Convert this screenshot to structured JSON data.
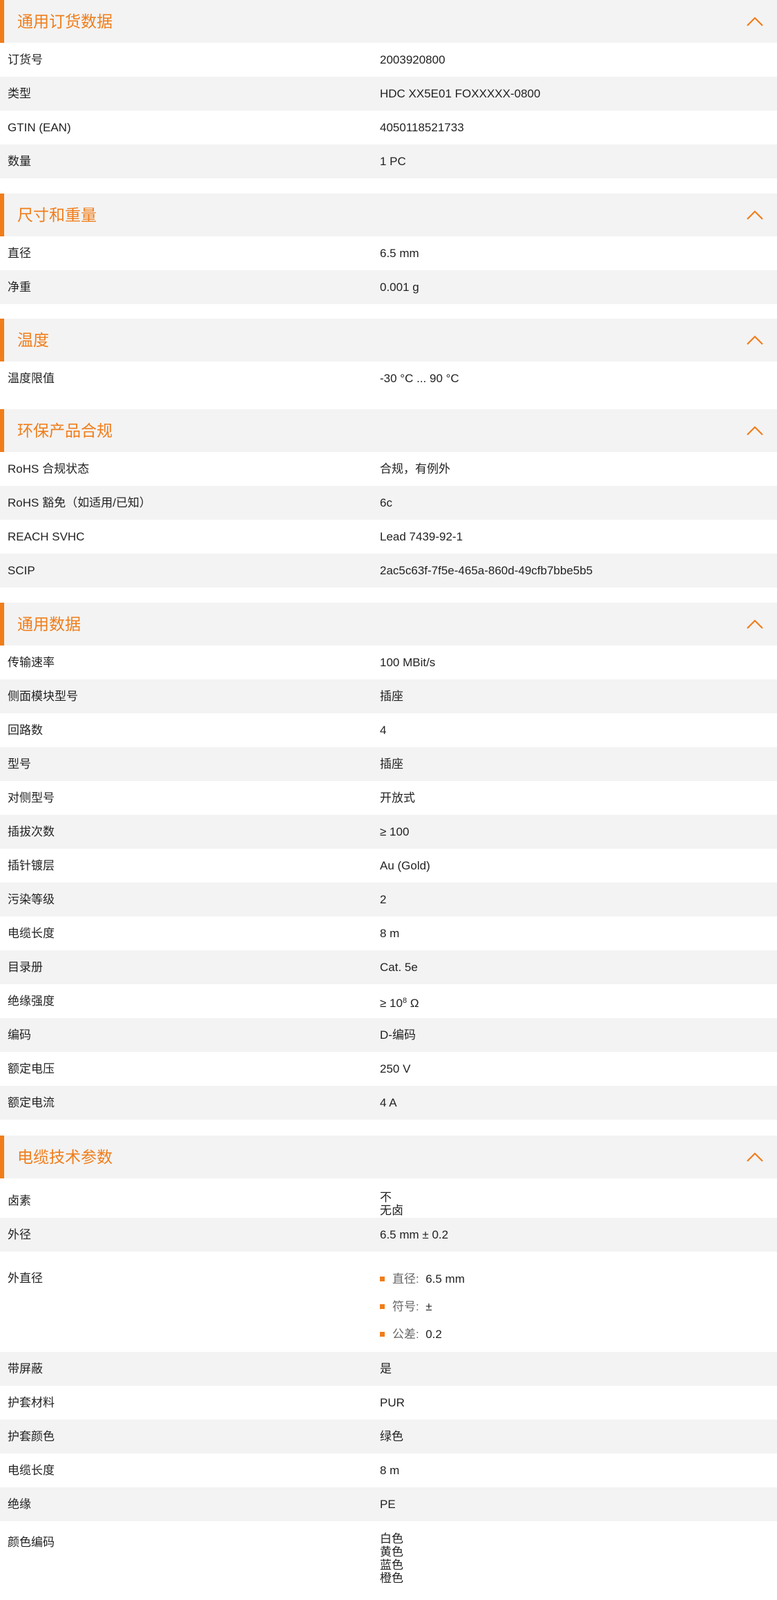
{
  "accent_color": "#f07d1a",
  "sections": [
    {
      "title": "通用订货数据",
      "rows": [
        {
          "label": "订货号",
          "value": "2003920800"
        },
        {
          "label": "类型",
          "value": "HDC XX5E01 FOXXXXX-0800"
        },
        {
          "label": "GTIN (EAN)",
          "value": "4050118521733"
        },
        {
          "label": "数量",
          "value": "1  PC"
        }
      ]
    },
    {
      "title": "尺寸和重量",
      "rows": [
        {
          "label": "直径",
          "value": "6.5  mm"
        },
        {
          "label": "净重",
          "value": "0.001  g"
        }
      ]
    },
    {
      "title": "温度",
      "rows": [
        {
          "label": "温度限值",
          "value": "-30 °C ... 90 °C"
        }
      ]
    },
    {
      "title": "环保产品合规",
      "rows": [
        {
          "label": "RoHS 合规状态",
          "value": "合规，有例外"
        },
        {
          "label": "RoHS 豁免（如适用/已知）",
          "value": "6c"
        },
        {
          "label": "REACH SVHC",
          "value": "Lead 7439-92-1"
        },
        {
          "label": "SCIP",
          "value": "2ac5c63f-7f5e-465a-860d-49cfb7bbe5b5"
        }
      ]
    },
    {
      "title": "通用数据",
      "rows": [
        {
          "label": "传输速率",
          "value": "100 MBit/s"
        },
        {
          "label": "侧面模块型号",
          "value": "插座"
        },
        {
          "label": "回路数",
          "value": "4"
        },
        {
          "label": "型号",
          "value": "插座"
        },
        {
          "label": "对侧型号",
          "value": "开放式"
        },
        {
          "label": "插拔次数",
          "value": "≥ 100"
        },
        {
          "label": "插针镀层",
          "value": "Au (Gold)"
        },
        {
          "label": "污染等级",
          "value": "2"
        },
        {
          "label": "电缆长度",
          "value": "8  m"
        },
        {
          "label": "目录册",
          "value": "Cat. 5e"
        },
        {
          "label": "绝缘强度",
          "value_prefix": "≥ 10",
          "value_sup": "8",
          "value_suffix": " Ω"
        },
        {
          "label": "编码",
          "value": "D-编码"
        },
        {
          "label": "额定电压",
          "value": "250  V"
        },
        {
          "label": "额定电流",
          "value": "4  A"
        }
      ]
    },
    {
      "title": "电缆技术参数",
      "rows": [
        {
          "label": "卤素",
          "values": [
            "不",
            "无卤"
          ]
        },
        {
          "label": "外径",
          "value": "6.5 mm ± 0.2"
        },
        {
          "label": "外直径",
          "bullets": [
            {
              "key": "直径:",
              "value": "6.5 mm"
            },
            {
              "key": "符号:",
              "value": "±"
            },
            {
              "key": "公差:",
              "value": "0.2"
            }
          ]
        },
        {
          "label": "带屏蔽",
          "value": "是"
        },
        {
          "label": "护套材料",
          "value": "PUR"
        },
        {
          "label": "护套颜色",
          "value": "绿色"
        },
        {
          "label": "电缆长度",
          "value": "8  m"
        },
        {
          "label": "绝缘",
          "value": "PE"
        },
        {
          "label": "颜色编码",
          "values": [
            "白色",
            "黄色",
            "蓝色",
            "橙色"
          ]
        }
      ]
    }
  ]
}
